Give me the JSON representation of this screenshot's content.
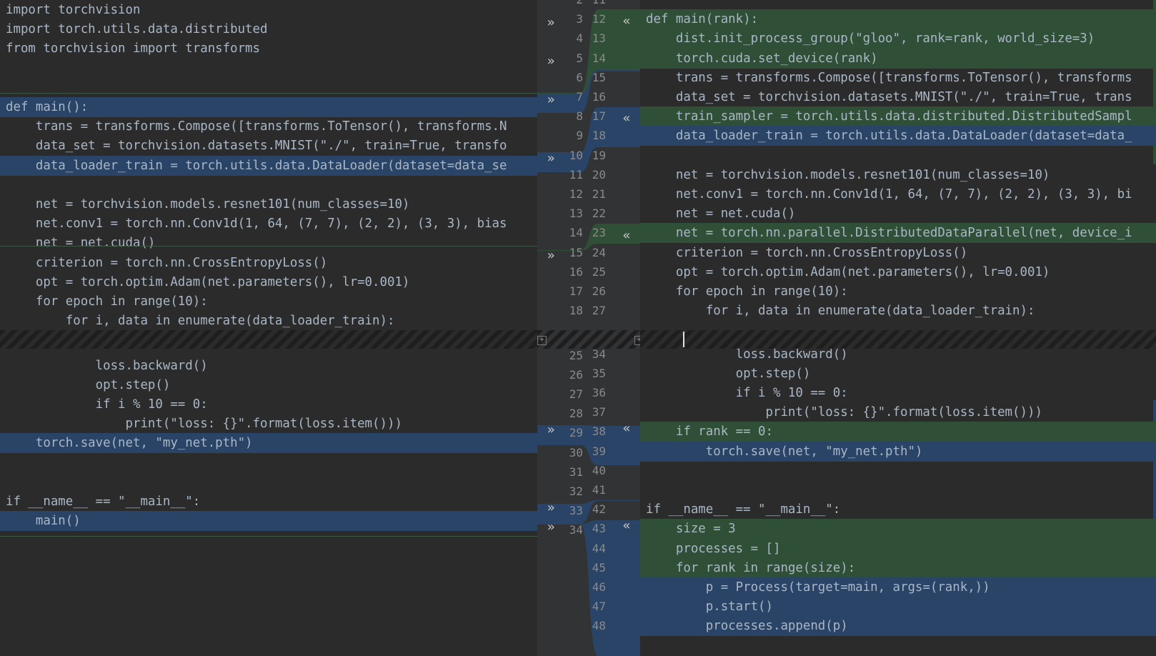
{
  "left": {
    "lines": [
      {
        "text": "import torchvision",
        "hl": ""
      },
      {
        "text": "import torch.utils.data.distributed",
        "hl": ""
      },
      {
        "text": "from torchvision import transforms",
        "hl": ""
      },
      {
        "text": "",
        "hl": ""
      },
      {
        "text": "",
        "hl": ""
      },
      {
        "text": "def main():",
        "hl": "mod"
      },
      {
        "text": "    trans = transforms.Compose([transforms.ToTensor(), transforms.N",
        "hl": ""
      },
      {
        "text": "    data_set = torchvision.datasets.MNIST(\"./\", train=True, transfo",
        "hl": ""
      },
      {
        "text": "    data_loader_train = torch.utils.data.DataLoader(dataset=data_se",
        "hl": "mod"
      },
      {
        "text": "",
        "hl": ""
      },
      {
        "text": "    net = torchvision.models.resnet101(num_classes=10)",
        "hl": ""
      },
      {
        "text": "    net.conv1 = torch.nn.Conv1d(1, 64, (7, 7), (2, 2), (3, 3), bias",
        "hl": ""
      },
      {
        "text": "    net = net.cuda()",
        "hl": ""
      },
      {
        "text": "    criterion = torch.nn.CrossEntropyLoss()",
        "hl": ""
      },
      {
        "text": "    opt = torch.optim.Adam(net.parameters(), lr=0.001)",
        "hl": ""
      },
      {
        "text": "    for epoch in range(10):",
        "hl": ""
      },
      {
        "text": "        for i, data in enumerate(data_loader_train):",
        "hl": ""
      },
      {
        "text": "            loss.backward()",
        "hl": ""
      },
      {
        "text": "            opt.step()",
        "hl": ""
      },
      {
        "text": "            if i % 10 == 0:",
        "hl": ""
      },
      {
        "text": "                print(\"loss: {}\".format(loss.item()))",
        "hl": ""
      },
      {
        "text": "    torch.save(net, \"my_net.pth\")",
        "hl": "mod"
      },
      {
        "text": "",
        "hl": ""
      },
      {
        "text": "",
        "hl": ""
      },
      {
        "text": "if __name__ == \"__main__\":",
        "hl": ""
      },
      {
        "text": "    main()",
        "hl": "mod"
      }
    ],
    "numbers": [
      "2",
      "3",
      "4",
      "5",
      "6",
      "7",
      "8",
      "9",
      "10",
      "11",
      "12",
      "13",
      "14",
      "15",
      "16",
      "17",
      "18",
      "25",
      "26",
      "27",
      "28",
      "29",
      "30",
      "31",
      "32",
      "33",
      "34"
    ]
  },
  "right": {
    "lines": [
      {
        "text": "",
        "hl": ""
      },
      {
        "text": "def main(rank):",
        "hl": "add"
      },
      {
        "text": "    dist.init_process_group(\"gloo\", rank=rank, world_size=3)",
        "hl": "add"
      },
      {
        "text": "    torch.cuda.set_device(rank)",
        "hl": "add"
      },
      {
        "text": "    trans = transforms.Compose([transforms.ToTensor(), transforms",
        "hl": ""
      },
      {
        "text": "    data_set = torchvision.datasets.MNIST(\"./\", train=True, trans",
        "hl": ""
      },
      {
        "text": "    train_sampler = torch.utils.data.distributed.DistributedSampl",
        "hl": "add"
      },
      {
        "text": "    data_loader_train = torch.utils.data.DataLoader(dataset=data_",
        "hl": "mod"
      },
      {
        "text": "",
        "hl": ""
      },
      {
        "text": "    net = torchvision.models.resnet101(num_classes=10)",
        "hl": ""
      },
      {
        "text": "    net.conv1 = torch.nn.Conv1d(1, 64, (7, 7), (2, 2), (3, 3), bi",
        "hl": ""
      },
      {
        "text": "    net = net.cuda()",
        "hl": ""
      },
      {
        "text": "    net = torch.nn.parallel.DistributedDataParallel(net, device_i",
        "hl": "add"
      },
      {
        "text": "    criterion = torch.nn.CrossEntropyLoss()",
        "hl": ""
      },
      {
        "text": "    opt = torch.optim.Adam(net.parameters(), lr=0.001)",
        "hl": ""
      },
      {
        "text": "    for epoch in range(10):",
        "hl": ""
      },
      {
        "text": "        for i, data in enumerate(data_loader_train):",
        "hl": ""
      },
      {
        "text": "            loss.backward()",
        "hl": ""
      },
      {
        "text": "            opt.step()",
        "hl": ""
      },
      {
        "text": "            if i % 10 == 0:",
        "hl": ""
      },
      {
        "text": "                print(\"loss: {}\".format(loss.item()))",
        "hl": ""
      },
      {
        "text": "    if rank == 0:",
        "hl": "add"
      },
      {
        "text": "        torch.save(net, \"my_net.pth\")",
        "hl": "mod"
      },
      {
        "text": "",
        "hl": ""
      },
      {
        "text": "",
        "hl": ""
      },
      {
        "text": "if __name__ == \"__main__\":",
        "hl": ""
      },
      {
        "text": "    size = 3",
        "hl": "add"
      },
      {
        "text": "    processes = []",
        "hl": "add"
      },
      {
        "text": "    for rank in range(size):",
        "hl": "add"
      },
      {
        "text": "        p = Process(target=main, args=(rank,))",
        "hl": "mod"
      },
      {
        "text": "        p.start()",
        "hl": "mod"
      },
      {
        "text": "        processes.append(p)",
        "hl": "mod"
      }
    ],
    "numbers": [
      "11",
      "12",
      "13",
      "14",
      "15",
      "16",
      "17",
      "18",
      "19",
      "20",
      "21",
      "22",
      "23",
      "24",
      "25",
      "26",
      "27",
      "34",
      "35",
      "36",
      "37",
      "38",
      "39",
      "40",
      "41",
      "42",
      "43",
      "44",
      "45",
      "46",
      "47",
      "48"
    ]
  },
  "markers": {
    "apply_right": "»",
    "apply_left": "«",
    "expand": "+"
  },
  "colors": {
    "modified": "#294466",
    "added": "#2f4f36",
    "background": "#2b2b2b"
  }
}
